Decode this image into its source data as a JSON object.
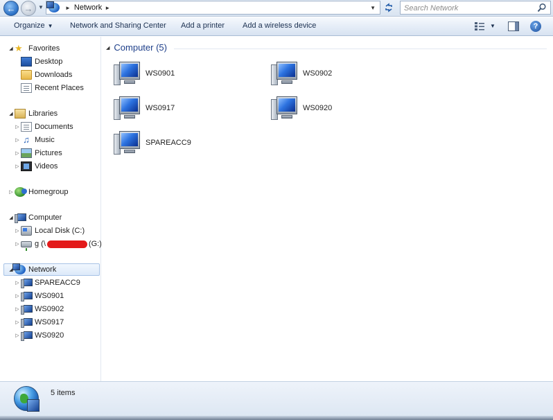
{
  "address_bar": {
    "breadcrumb": "Network",
    "search_placeholder": "Search Network"
  },
  "toolbar": {
    "organize": "Organize",
    "network_sharing": "Network and Sharing Center",
    "add_printer": "Add a printer",
    "add_wireless": "Add a wireless device"
  },
  "nav": {
    "favorites": {
      "label": "Favorites",
      "items": [
        "Desktop",
        "Downloads",
        "Recent Places"
      ]
    },
    "libraries": {
      "label": "Libraries",
      "items": [
        "Documents",
        "Music",
        "Pictures",
        "Videos"
      ]
    },
    "homegroup": "Homegroup",
    "computer": {
      "label": "Computer",
      "local_disk": "Local Disk (C:)",
      "net_drive_prefix": "g (\\",
      "net_drive_suffix": "(G:)"
    },
    "network": {
      "label": "Network",
      "items": [
        "SPAREACC9",
        "WS0901",
        "WS0902",
        "WS0917",
        "WS0920"
      ]
    }
  },
  "content": {
    "group_header": "Computer (5)",
    "computers": [
      "WS0901",
      "WS0902",
      "WS0917",
      "WS0920",
      "SPAREACC9"
    ]
  },
  "status": {
    "item_count": "5 items"
  },
  "colors": {
    "accent": "#1e3f8a",
    "selection": "#dce9f9",
    "redaction": "#e31a1a"
  }
}
